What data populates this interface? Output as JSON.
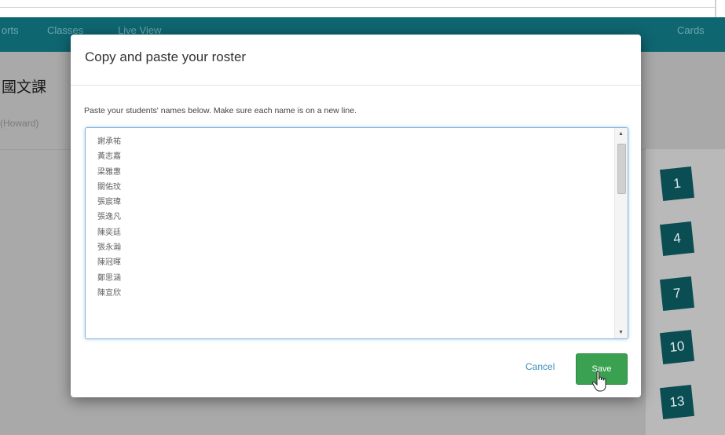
{
  "navbar": {
    "items": [
      "orts",
      "Classes",
      "Live View"
    ],
    "right_item": "Cards"
  },
  "class_title": "國文課",
  "teacher_name": "(Howard)",
  "seats": [
    "1",
    "4",
    "7",
    "10",
    "13"
  ],
  "modal": {
    "title": "Copy and paste your roster",
    "instructions": "Paste your students' names below. Make sure each name is on a new line.",
    "roster_names": [
      "謝承祐",
      "黃志嘉",
      "梁雅惠",
      "關佑玟",
      "張宸瑋",
      "張逸凡",
      "陳奕廷",
      "張永瀚",
      "陳冠暉",
      "鄭思涵",
      "陳宣欣"
    ],
    "cancel_label": "Cancel",
    "save_label": "Save"
  },
  "colors": {
    "navbar": "#0e6671",
    "seat": "#0a4d53",
    "save": "#39a150",
    "link": "#3b8fb8"
  }
}
